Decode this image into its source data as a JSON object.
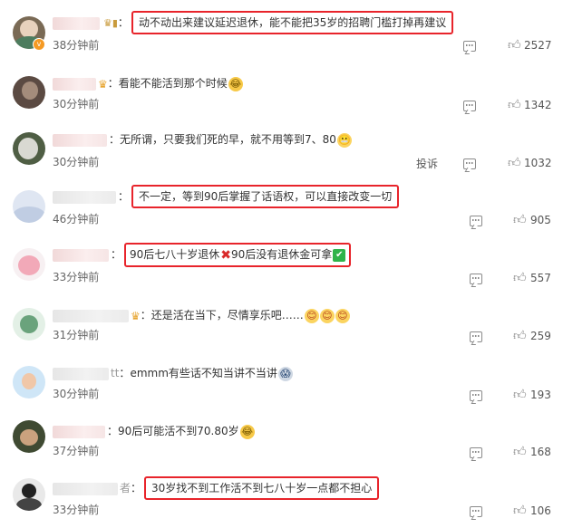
{
  "comments": [
    {
      "text": "动不动出来建议延迟退休，能不能把35岁的招聘门槛打掉再建议",
      "time": "38分钟前",
      "likes": "2527"
    },
    {
      "text": "看能不能活到那个时候",
      "time": "30分钟前",
      "likes": "1342"
    },
    {
      "text": "无所谓，只要我们死的早，就不用等到7、80",
      "time": "30分钟前",
      "likes": "1032",
      "report": "投诉"
    },
    {
      "text": "不一定，等到90后掌握了话语权，可以直接改变一切",
      "time": "46分钟前",
      "likes": "905"
    },
    {
      "text_a": "90后七八十岁退休",
      "text_b": "90后没有退休金可拿",
      "time": "33分钟前",
      "likes": "557"
    },
    {
      "text": "还是活在当下，尽情享乐吧……",
      "time": "31分钟前",
      "likes": "259"
    },
    {
      "user_suffix": "tt",
      "text": "emmm有些话不知当讲不当讲",
      "time": "30分钟前",
      "likes": "193"
    },
    {
      "text": "90后可能活不到70.80岁",
      "time": "37分钟前",
      "likes": "168"
    },
    {
      "user_suffix": "者",
      "text": "30岁找不到工作活不到七八十岁一点都不担心",
      "time": "33分钟前",
      "likes": "106"
    }
  ],
  "colors": {
    "highlight_border": "#e8242b",
    "meta_text": "#666666",
    "icon": "#8a8a8a"
  },
  "icons": {
    "comment": "comment-icon",
    "like": "thumbs-up-icon",
    "vip": "crown-icon"
  }
}
